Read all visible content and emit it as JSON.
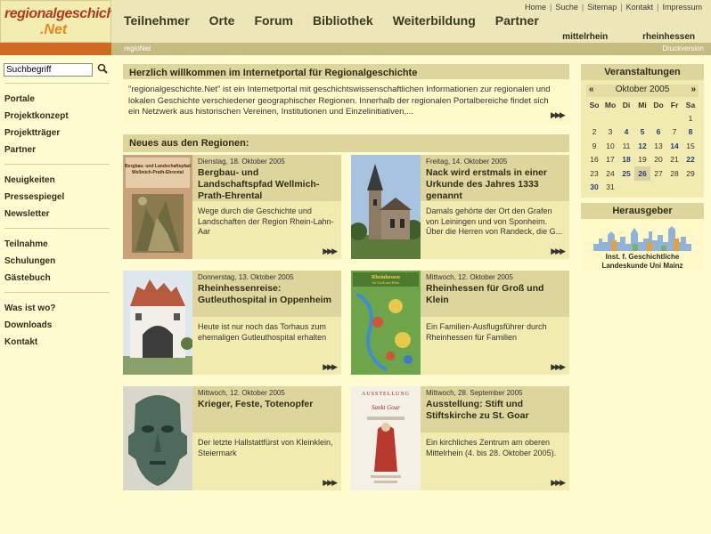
{
  "logo": {
    "line1": "regionalgeschichte",
    "line2": ".Net"
  },
  "header": {
    "main_nav": [
      "Teilnehmer",
      "Orte",
      "Forum",
      "Bibliothek",
      "Weiterbildung",
      "Partner"
    ],
    "util_nav": [
      "Home",
      "Suche",
      "Sitemap",
      "Kontakt",
      "Impressum"
    ],
    "regions": [
      "mittelrhein",
      "rheinhessen"
    ],
    "sub_left": "regioNet",
    "sub_right": "Druckversion"
  },
  "search": {
    "value": "Suchbegriff"
  },
  "sidebar": {
    "group1": [
      "Portale",
      "Projektkonzept",
      "Projektträger",
      "Partner"
    ],
    "group2": [
      "Neuigkeiten",
      "Pressespiegel",
      "Newsletter"
    ],
    "group3": [
      "Teilnahme",
      "Schulungen",
      "Gästebuch"
    ],
    "group4": [
      "Was ist wo?",
      "Downloads",
      "Kontakt"
    ]
  },
  "welcome": {
    "title": "Herzlich willkommen im Internetportal für Regionalgeschichte",
    "text": "\"regionalgeschichte.Net\" ist ein Internetportal mit geschichtswissenschaftlichen Informationen zur regionalen und lokalen Geschichte verschiedener geographischer Regionen. Innerhalb der regionalen Portalbereiche findet sich ein Netzwerk aus historischen Vereinen, Institutionen und Einzelinitiativen,...",
    "more": "▶▶▶"
  },
  "news": {
    "title": "Neues aus den Regionen:",
    "items": [
      {
        "date": "Dienstag, 18. Oktober 2005",
        "title": "Bergbau- und Landschaftspfad Wellmich-Prath-Ehrental",
        "text": "Wege durch die Geschichte und Landschaften der Region Rhein-Lahn-Aar",
        "more": "▶▶▶"
      },
      {
        "date": "Freitag, 14. Oktober 2005",
        "title": "Nack wird erstmals in einer Urkunde des Jahres 1333 genannt",
        "text": "Damals gehörte der Ort den Grafen von Leiningen und von Sponheim. Über die Herren von Randeck, die G...",
        "more": "▶▶▶"
      },
      {
        "date": "Donnerstag, 13. Oktober 2005",
        "title": "Rheinhessenreise: Gutleuthospital in Oppenheim",
        "text": "Heute ist nur noch das Torhaus zum ehemaligen Gutleuthospital erhalten",
        "more": "▶▶▶"
      },
      {
        "date": "Mittwoch, 12. Oktober 2005",
        "title": "Rheinhessen für Groß und Klein",
        "text": "Ein Familien-Ausflugsführer durch Rheinhessen für Familien",
        "more": "▶▶▶"
      },
      {
        "date": "Mittwoch, 12. Oktober 2005",
        "title": "Krieger, Feste, Totenopfer",
        "text": "Der letzte Hallstattfürst von Kleinklein, Steiermark",
        "more": "▶▶▶"
      },
      {
        "date": "Mittwoch, 28. September 2005",
        "title": "Ausstellung: Stift und Stiftskirche zu St. Goar",
        "text": "Ein kirchliches Zentrum am oberen Mittelrhein (4. bis 28. Oktober 2005).",
        "more": "▶▶▶"
      }
    ]
  },
  "thumbs": {
    "book": {
      "t1": "Bergbau- und Landschaftspfad",
      "t2": "Wellmich-Prath-Ehrental"
    },
    "map": {
      "t1": "Rheinhessen",
      "t2": "für Groß und Klein"
    },
    "poster": {
      "t1": "AUSSTELLUNG",
      "t2": "Sankt Goar"
    }
  },
  "events": {
    "title": "Veranstaltungen",
    "month": "Oktober 2005",
    "prev": "«",
    "next": "»",
    "weekdays": [
      "So",
      "Mo",
      "Di",
      "Mi",
      "Do",
      "Fr",
      "Sa"
    ],
    "weeks": [
      [
        "",
        "",
        "",
        "",
        "",
        "",
        "1"
      ],
      [
        "2",
        "3",
        "4",
        "5",
        "6",
        "7",
        "8"
      ],
      [
        "9",
        "10",
        "11",
        "12",
        "13",
        "14",
        "15"
      ],
      [
        "16",
        "17",
        "18",
        "19",
        "20",
        "21",
        "22"
      ],
      [
        "23",
        "24",
        "25",
        "26",
        "27",
        "28",
        "29"
      ],
      [
        "30",
        "31",
        "",
        "",
        "",
        "",
        ""
      ]
    ],
    "event_days": [
      "4",
      "5",
      "6",
      "8",
      "12",
      "14",
      "18",
      "22",
      "25",
      "26",
      "30"
    ],
    "today": "26"
  },
  "publisher": {
    "title": "Herausgeber",
    "name_line1": "Inst. f. Geschichtliche",
    "name_line2": "Landeskunde Uni Mainz"
  }
}
